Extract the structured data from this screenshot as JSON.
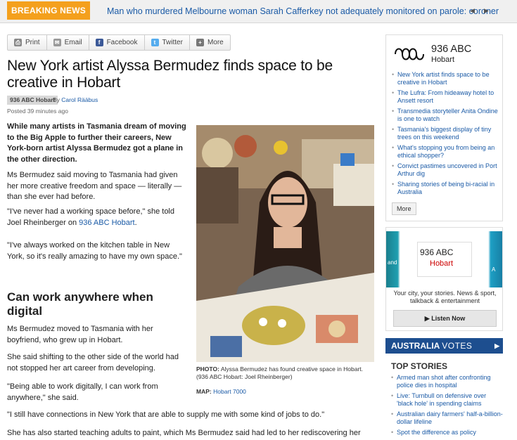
{
  "breaking_news": {
    "label": "BREAKING NEWS",
    "headline": "Man who murdered Melbourne woman Sarah Cafferkey not adequately monitored on parole: coroner",
    "prev": "◀",
    "next": "▶"
  },
  "share": {
    "print": "Print",
    "email": "Email",
    "facebook": "Facebook",
    "twitter": "Twitter",
    "more": "More"
  },
  "article": {
    "headline": "New York artist Alyssa Bermudez finds space to be creative in Hobart",
    "station_badge": "936 ABC Hobart",
    "by": "By",
    "author": "Carol Rääbus",
    "posted": "Posted 39 minutes ago",
    "lead": "While many artists in Tasmania dream of moving to the Big Apple to further their careers, New York-born artist Alyssa Bermudez got a plane in the other direction.",
    "p1": "Ms Bermudez said moving to Tasmania had given her more creative freedom and space — literally — than she ever had before.",
    "p2_a": "\"I've never had a working space before,\" she told Joel Rheinberger on ",
    "p2_link": "936 ABC Hobart",
    "p2_b": ".",
    "p3": "\"I've always worked on the kitchen table in New York, so it's really amazing to have my own space.\"",
    "subhead": "Can work anywhere when digital",
    "p4": "Ms Bermudez moved to Tasmania with her boyfriend, who grew up in Hobart.",
    "p5": "She said shifting to the other side of the world had not stopped her art career from developing.",
    "p6": "\"Being able to work digitally, I can work from anywhere,\" she said.",
    "p7": "\"I still have connections in New York that are able to supply me with some kind of jobs to do.\"",
    "p8": "She has also started teaching adults to paint, which Ms Bermudez said had led to her rediscovering her",
    "photo_caption_label": "PHOTO:",
    "photo_caption": "Alyssa Bermudez has found creative space in Hobart.",
    "photo_credit": "(936 ABC Hobart: Joel Rheinberger)",
    "map_label": "MAP:",
    "map_link": "Hobart 7000"
  },
  "sidebar": {
    "station_name": "936 ABC",
    "station_city": "Hobart",
    "stories": [
      "New York artist finds space to be creative in Hobart",
      "The Lufra: From hideaway hotel to Ansett resort",
      "Transmedia storyteller Anita Ondine is one to watch",
      "Tasmania's biggest display of tiny trees on this weekend",
      "What's stopping you from being an ethical shopper?",
      "Convict pastimes uncovered in Port Arthur dig",
      "Sharing stories of being bi-racial in Australia"
    ],
    "more": "More",
    "radio_name": "936 ABC",
    "radio_city": "Hobart",
    "radio_left_fragment": "and",
    "radio_right_fragment": "A",
    "radio_tagline": "Your city, your stories. News & sport, talkback & entertainment",
    "listen": "▶  Listen Now",
    "australia": "AUSTRALIA",
    "votes": "VOTES",
    "votes_arrow": "▶",
    "top_stories_title": "TOP STORIES",
    "top_stories": [
      "Armed man shot after confronting police dies in hospital",
      "Live: Turnbull on defensive over 'black hole' in spending claims",
      "Australian dairy farmers' half-a-billion-dollar lifeline",
      "Spot the difference as policy"
    ]
  },
  "colors": {
    "breaking_label_bg": "#f4a01d",
    "link": "#1a5aa6",
    "votes_bar": "#1d4e8f",
    "accent_red": "#cc0000"
  }
}
